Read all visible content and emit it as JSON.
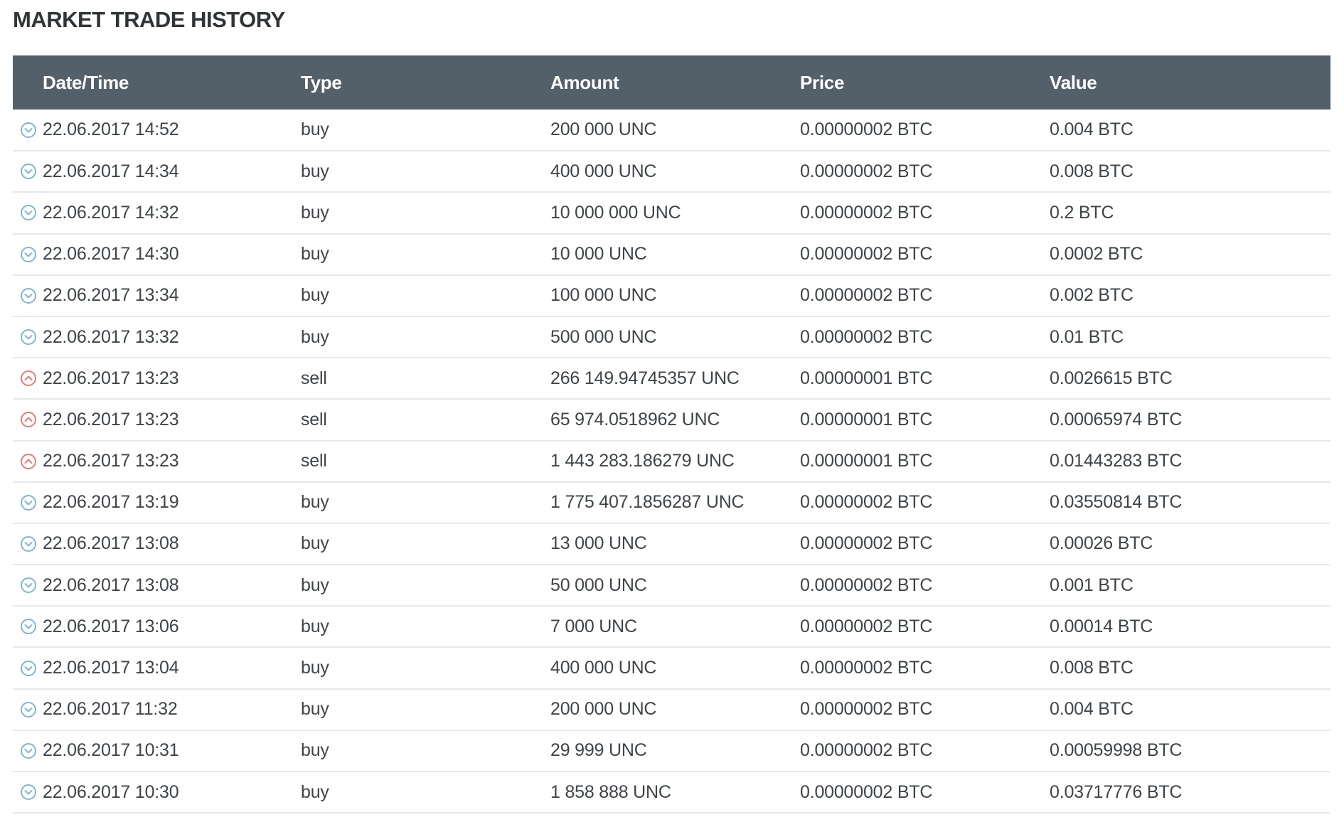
{
  "page": {
    "title": "MARKET TRADE HISTORY"
  },
  "colors": {
    "header_bg": "#53606a",
    "buy_icon": "#7fb6d6",
    "sell_icon": "#e57b78",
    "row_divider": "#e6e8ea"
  },
  "table": {
    "columns": [
      "Date/Time",
      "Type",
      "Amount",
      "Price",
      "Value"
    ],
    "rows": [
      {
        "datetime": "22.06.2017 14:52",
        "type": "buy",
        "amount": "200 000 UNC",
        "price": "0.00000002 BTC",
        "value": "0.004 BTC",
        "icon": "chevron-down-circle-icon"
      },
      {
        "datetime": "22.06.2017 14:34",
        "type": "buy",
        "amount": "400 000 UNC",
        "price": "0.00000002 BTC",
        "value": "0.008 BTC",
        "icon": "chevron-down-circle-icon"
      },
      {
        "datetime": "22.06.2017 14:32",
        "type": "buy",
        "amount": "10 000 000 UNC",
        "price": "0.00000002 BTC",
        "value": "0.2 BTC",
        "icon": "chevron-down-circle-icon"
      },
      {
        "datetime": "22.06.2017 14:30",
        "type": "buy",
        "amount": "10 000 UNC",
        "price": "0.00000002 BTC",
        "value": "0.0002 BTC",
        "icon": "chevron-down-circle-icon"
      },
      {
        "datetime": "22.06.2017 13:34",
        "type": "buy",
        "amount": "100 000 UNC",
        "price": "0.00000002 BTC",
        "value": "0.002 BTC",
        "icon": "chevron-down-circle-icon"
      },
      {
        "datetime": "22.06.2017 13:32",
        "type": "buy",
        "amount": "500 000 UNC",
        "price": "0.00000002 BTC",
        "value": "0.01 BTC",
        "icon": "chevron-down-circle-icon"
      },
      {
        "datetime": "22.06.2017 13:23",
        "type": "sell",
        "amount": "266 149.94745357 UNC",
        "price": "0.00000001 BTC",
        "value": "0.0026615 BTC",
        "icon": "chevron-up-circle-icon"
      },
      {
        "datetime": "22.06.2017 13:23",
        "type": "sell",
        "amount": "65 974.0518962 UNC",
        "price": "0.00000001 BTC",
        "value": "0.00065974 BTC",
        "icon": "chevron-up-circle-icon"
      },
      {
        "datetime": "22.06.2017 13:23",
        "type": "sell",
        "amount": "1 443 283.186279 UNC",
        "price": "0.00000001 BTC",
        "value": "0.01443283 BTC",
        "icon": "chevron-up-circle-icon"
      },
      {
        "datetime": "22.06.2017 13:19",
        "type": "buy",
        "amount": "1 775 407.1856287 UNC",
        "price": "0.00000002 BTC",
        "value": "0.03550814 BTC",
        "icon": "chevron-down-circle-icon"
      },
      {
        "datetime": "22.06.2017 13:08",
        "type": "buy",
        "amount": "13 000 UNC",
        "price": "0.00000002 BTC",
        "value": "0.00026 BTC",
        "icon": "chevron-down-circle-icon"
      },
      {
        "datetime": "22.06.2017 13:08",
        "type": "buy",
        "amount": "50 000 UNC",
        "price": "0.00000002 BTC",
        "value": "0.001 BTC",
        "icon": "chevron-down-circle-icon"
      },
      {
        "datetime": "22.06.2017 13:06",
        "type": "buy",
        "amount": "7 000 UNC",
        "price": "0.00000002 BTC",
        "value": "0.00014 BTC",
        "icon": "chevron-down-circle-icon"
      },
      {
        "datetime": "22.06.2017 13:04",
        "type": "buy",
        "amount": "400 000 UNC",
        "price": "0.00000002 BTC",
        "value": "0.008 BTC",
        "icon": "chevron-down-circle-icon"
      },
      {
        "datetime": "22.06.2017 11:32",
        "type": "buy",
        "amount": "200 000 UNC",
        "price": "0.00000002 BTC",
        "value": "0.004 BTC",
        "icon": "chevron-down-circle-icon"
      },
      {
        "datetime": "22.06.2017 10:31",
        "type": "buy",
        "amount": "29 999 UNC",
        "price": "0.00000002 BTC",
        "value": "0.00059998 BTC",
        "icon": "chevron-down-circle-icon"
      },
      {
        "datetime": "22.06.2017 10:30",
        "type": "buy",
        "amount": "1 858 888 UNC",
        "price": "0.00000002 BTC",
        "value": "0.03717776 BTC",
        "icon": "chevron-down-circle-icon"
      }
    ]
  }
}
